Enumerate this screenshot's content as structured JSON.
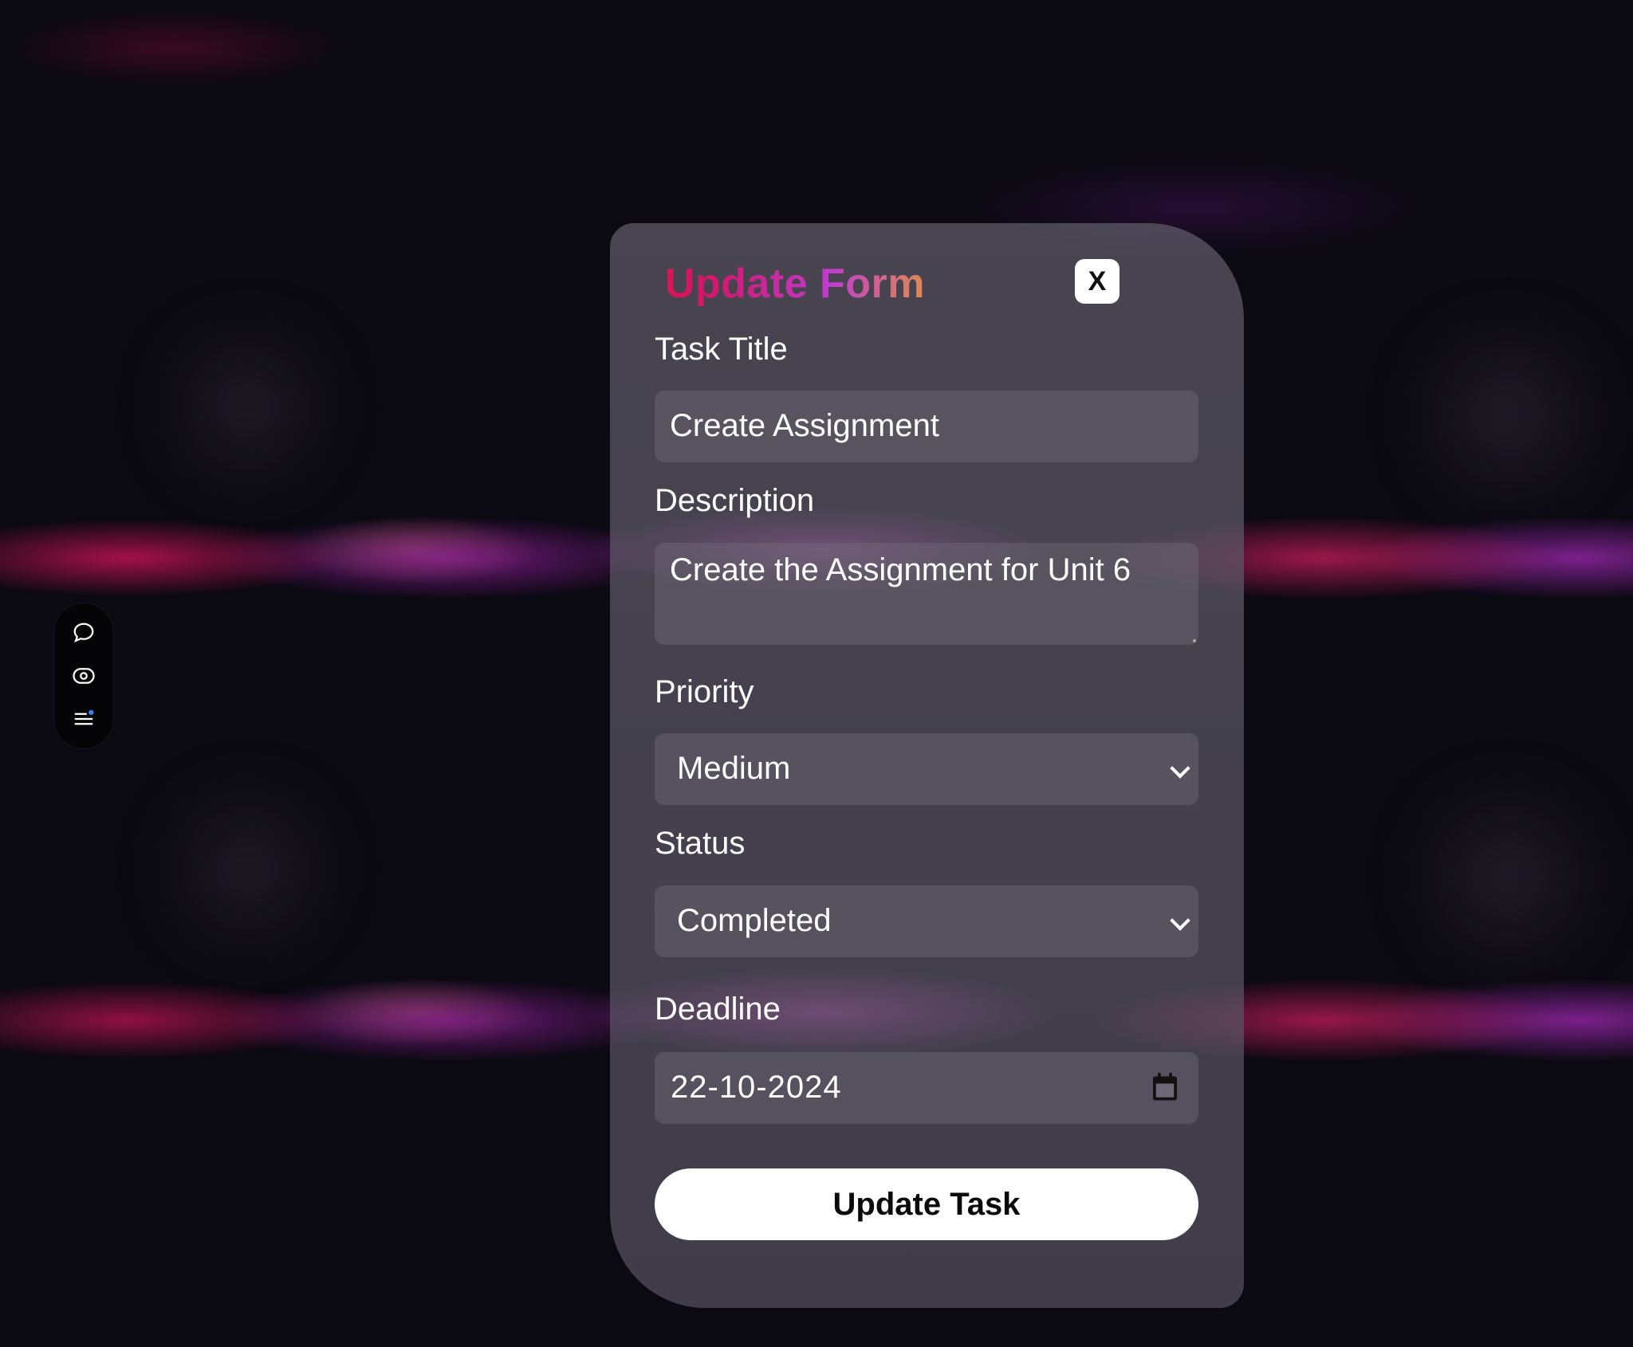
{
  "sidebar": {
    "icons": [
      "chat-bubble-icon",
      "eye-icon",
      "menu-list-icon"
    ],
    "notification_dot_color": "#3b82f6"
  },
  "form": {
    "title": "Update Form",
    "close_label": "X",
    "task_title_label": "Task Title",
    "task_title_value": "Create Assignment",
    "description_label": "Description",
    "description_value": "Create the Assignment for Unit 6",
    "priority_label": "Priority",
    "priority_value": "Medium",
    "status_label": "Status",
    "status_value": "Completed",
    "deadline_label": "Deadline",
    "deadline_value": "22-10-2024",
    "submit_label": "Update Task"
  },
  "colors": {
    "title_gradient": [
      "#e3103c",
      "#c03cd0",
      "#e08a50"
    ],
    "button_bg": "#ffffff"
  }
}
